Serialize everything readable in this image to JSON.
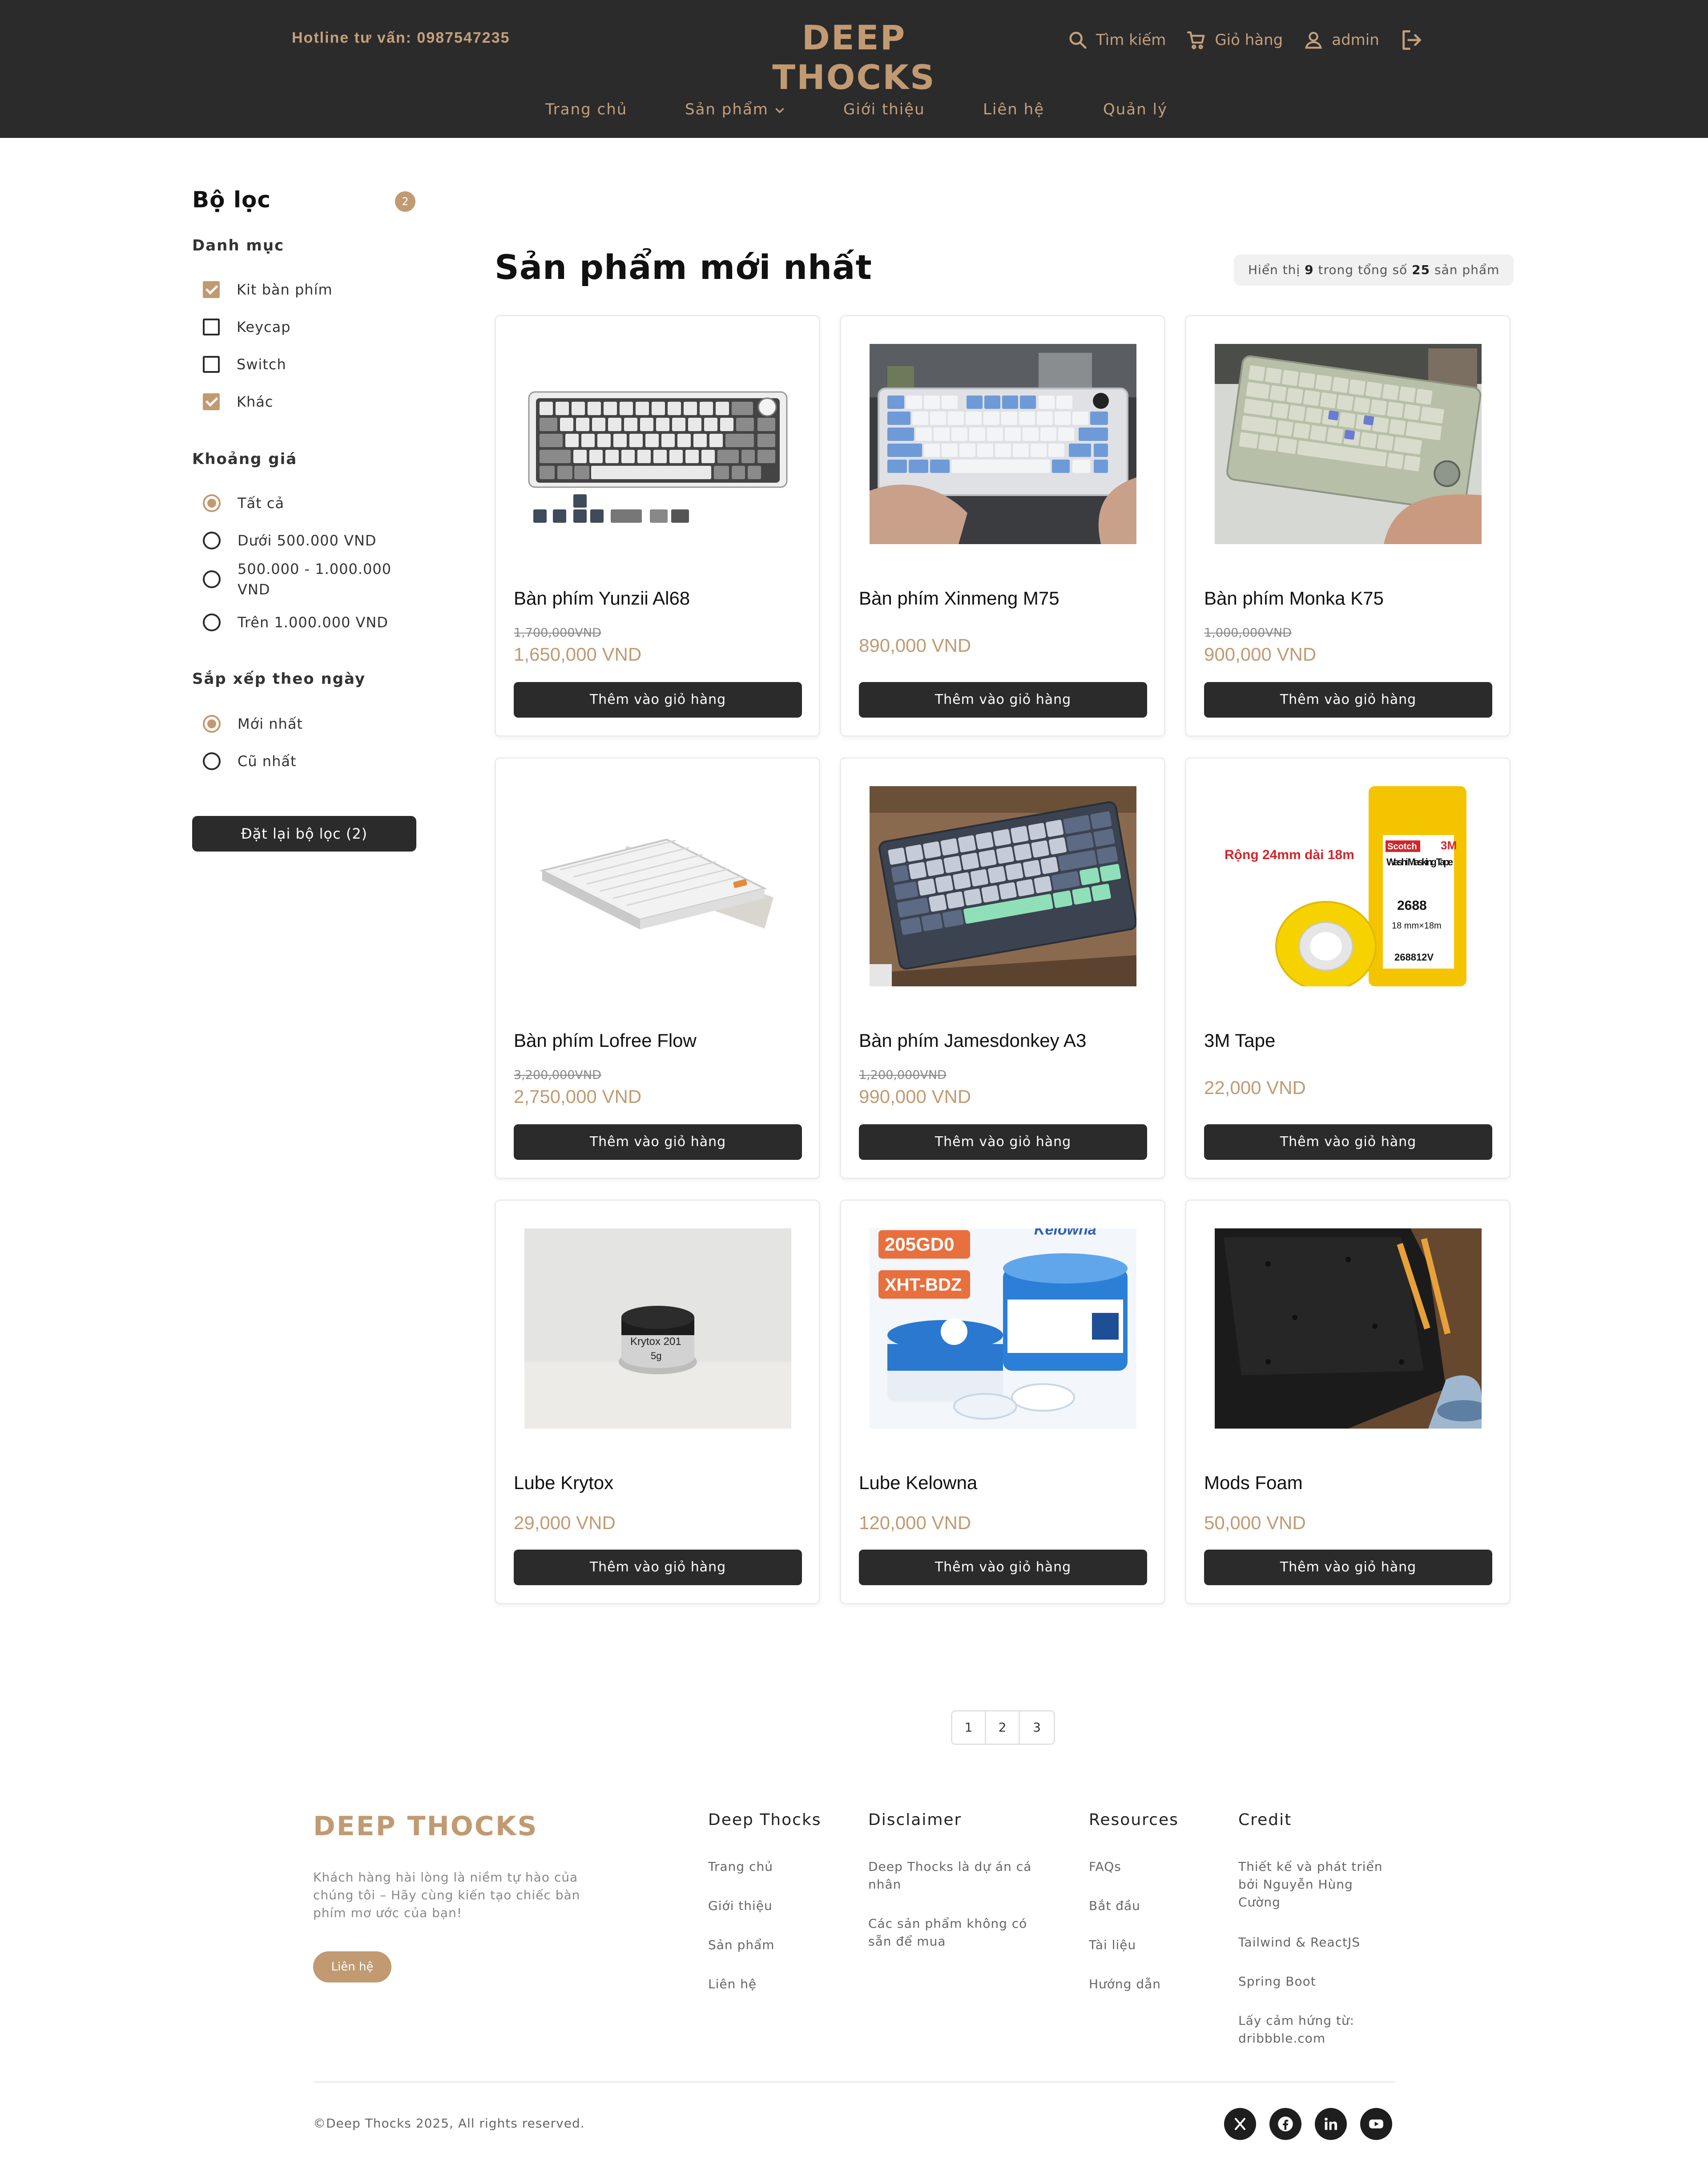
{
  "header": {
    "hotline_label": "Hotline tư vấn:",
    "hotline_number": "0987547235",
    "logo": "DEEP THOCKS",
    "search_label": "Tìm kiếm",
    "cart_label": "Giỏ hàng",
    "user_label": "admin",
    "nav": [
      {
        "label": "Trang chủ"
      },
      {
        "label": "Sản phẩm"
      },
      {
        "label": "Giới thiệu"
      },
      {
        "label": "Liên hệ"
      },
      {
        "label": "Quản lý"
      }
    ],
    "accent_color": "#c19a72",
    "icons": [
      "search-icon",
      "cart-icon",
      "user-icon",
      "logout-icon",
      "chevron-down-icon"
    ]
  },
  "sidebar": {
    "title": "Bộ lọc",
    "active_count": "2",
    "category_title": "Danh mục",
    "categories": [
      {
        "label": "Kit bàn phím",
        "checked": true
      },
      {
        "label": "Keycap",
        "checked": false
      },
      {
        "label": "Switch",
        "checked": false
      },
      {
        "label": "Khác",
        "checked": true
      }
    ],
    "price_title": "Khoảng giá",
    "prices": [
      {
        "label": "Tất cả",
        "selected": true
      },
      {
        "label": "Dưới 500.000 VND",
        "selected": false
      },
      {
        "label": "500.000 - 1.000.000 VND",
        "selected": false
      },
      {
        "label": "Trên 1.000.000 VND",
        "selected": false
      }
    ],
    "sort_title": "Sắp xếp theo ngày",
    "sorts": [
      {
        "label": "Mới nhất",
        "selected": true
      },
      {
        "label": "Cũ nhất",
        "selected": false
      }
    ],
    "reset_label": "Đặt lại bộ lọc (2)"
  },
  "main": {
    "title": "Sản phẩm mới nhất",
    "showing_prefix": "Hiển thị",
    "showing_count": "9",
    "showing_middle": "trong tổng số",
    "showing_total": "25",
    "showing_suffix": "sản phẩm",
    "add_to_cart": "Thêm vào giỏ hàng",
    "products": [
      {
        "name": "Bàn phím Yunzii Al68",
        "old_price": "1,700,000VND",
        "price": "1,650,000 VND",
        "image": "white-gray-keyboard"
      },
      {
        "name": "Bàn phím Xinmeng M75",
        "old_price": "",
        "price": "890,000 VND",
        "image": "blue-white-keyboard"
      },
      {
        "name": "Bàn phím Monka K75",
        "old_price": "1,000,000VND",
        "price": "900,000 VND",
        "image": "cream-keyboard"
      },
      {
        "name": "Bàn phím Lofree Flow",
        "old_price": "3,200,000VND",
        "price": "2,750,000 VND",
        "image": "low-profile-keyboard"
      },
      {
        "name": "Bàn phím Jamesdonkey A3",
        "old_price": "1,200,000VND",
        "price": "990,000 VND",
        "image": "gray-mint-keyboard"
      },
      {
        "name": "3M Tape",
        "old_price": "",
        "price": "22,000 VND",
        "image": "masking-tape"
      },
      {
        "name": "Lube Krytox",
        "old_price": "",
        "price": "29,000 VND",
        "image": "lube-jar"
      },
      {
        "name": "Lube Kelowna",
        "old_price": "",
        "price": "120,000 VND",
        "image": "lube-tubs"
      },
      {
        "name": "Mods Foam",
        "old_price": "",
        "price": "50,000 VND",
        "image": "foam-case"
      }
    ],
    "image_labels": {
      "tape_caption": "Rộng 24mm dài 18m",
      "tape_brand": "Scotch",
      "tape_product": "Washi Masking Tape",
      "tape_code": "2688",
      "tape_size": "18 mm×18m",
      "tape_sku": "268812V",
      "tape_maker": "3M",
      "krytox_label": "Krytox 201",
      "krytox_weight": "5g",
      "kelowna_brand": "Kelowna",
      "kelowna_code1": "205GD0",
      "kelowna_code2": "XHT-BDZ"
    }
  },
  "pagination": [
    "1",
    "2",
    "3"
  ],
  "footer": {
    "logo": "DEEP THOCKS",
    "description": "Khách hàng hài lòng là niềm tự hào của chúng tôi – Hãy cùng kiến tạo chiếc bàn phím mơ ước của bạn!",
    "contact_label": "Liên hệ",
    "columns": [
      {
        "title": "Deep Thocks",
        "links": [
          "Trang chủ",
          "Giới thiệu",
          "Sản phẩm",
          "Liên hệ"
        ]
      },
      {
        "title": "Disclaimer",
        "links": [
          "Deep Thocks là dự án cá nhân",
          "Các sản phẩm không có sẵn để mua"
        ]
      },
      {
        "title": "Resources",
        "links": [
          "FAQs",
          "Bắt đầu",
          "Tài liệu",
          "Hướng dẫn"
        ]
      },
      {
        "title": "Credit",
        "links": [
          "Thiết kế và phát triển bởi Nguyễn Hùng Cường",
          "Tailwind & ReactJS",
          "Spring Boot",
          "Lấy cảm hứng từ: dribbble.com"
        ]
      }
    ],
    "copyright": "©Deep Thocks 2025, All rights reserved.",
    "socials": [
      "x-icon",
      "facebook-icon",
      "linkedin-icon",
      "youtube-icon"
    ]
  }
}
